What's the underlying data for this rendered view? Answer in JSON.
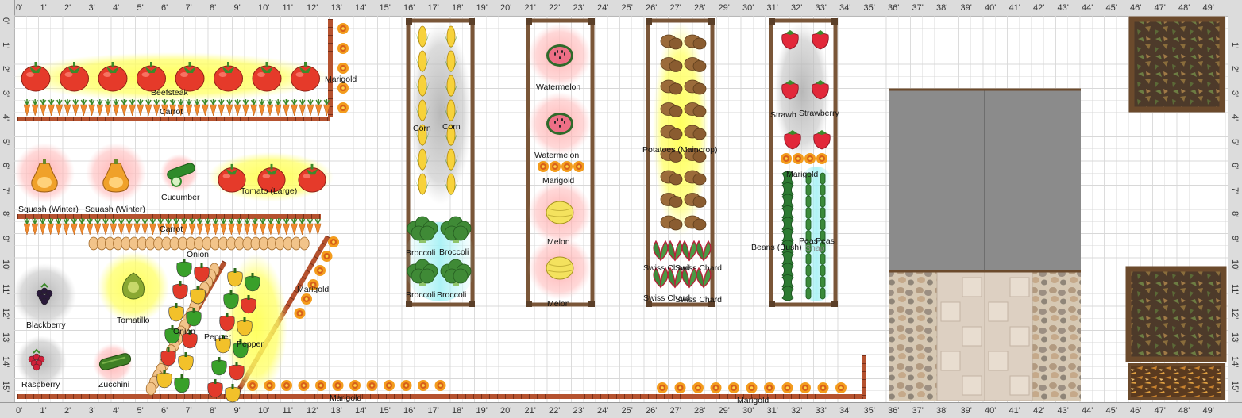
{
  "ruler": {
    "x_labels": [
      "0'",
      "1'",
      "2'",
      "3'",
      "4'",
      "5'",
      "6'",
      "7'",
      "8'",
      "9'",
      "10'",
      "11'",
      "12'",
      "13'",
      "14'",
      "15'",
      "16'",
      "17'",
      "18'",
      "19'",
      "20'",
      "21'",
      "22'",
      "23'",
      "24'",
      "25'",
      "26'",
      "27'",
      "28'",
      "29'",
      "30'",
      "31'",
      "32'",
      "33'",
      "34'",
      "35'",
      "36'",
      "37'",
      "38'",
      "39'",
      "40'",
      "41'",
      "42'",
      "43'",
      "44'",
      "45'",
      "46'",
      "47'",
      "48'",
      "49'"
    ],
    "y_labels": [
      "0'",
      "1'",
      "2'",
      "3'",
      "4'",
      "5'",
      "6'",
      "7'",
      "8'",
      "9'",
      "10'",
      "11'",
      "12'",
      "13'",
      "14'",
      "15'"
    ],
    "right_labels": [
      "1'",
      "2'",
      "3'",
      "4'",
      "5'",
      "6'",
      "7'",
      "8'",
      "9'",
      "10'",
      "11'",
      "12'",
      "13'",
      "14'",
      "15'"
    ]
  },
  "labels": {
    "beefsteak": "Beefsteak",
    "carrot": "Carrot",
    "marigold": "Marigold",
    "squash_winter": "Squash (Winter)",
    "cucumber": "Cucumber",
    "tomato_large": "Tomato (Large)",
    "onion": "Onion",
    "blackberry": "Blackberry",
    "tomatillo": "Tomatillo",
    "raspberry": "Raspberry",
    "zucchini": "Zucchini",
    "pepper": "Pepper",
    "corn": "Corn",
    "broccoli": "Broccoli",
    "watermelon": "Watermelon",
    "melon": "Melon",
    "potatoes": "Potatoes (Maincrop)",
    "swiss_chard": "Swiss Chard",
    "strawberry": "Strawberry",
    "strawb": "Strawb",
    "beans": "Beans (Bush)",
    "peas": "Peas",
    "snap": "Snap"
  },
  "colors": {
    "grid": "#d8d8d8",
    "ruler": "#dcdcdc",
    "bed_wood": "#7a5638",
    "sun_halo": "#ffff66",
    "warm_halo": "#ffb3b3",
    "shade_halo": "#bbbbbb",
    "water_halo": "#a8f0f4",
    "tomato": "#e53a2a",
    "carrot": "#f08a2c",
    "marigold": "#f39c1d",
    "brick": "#b5522f",
    "paving": "#8b8b8b",
    "stone": "#cbbba7"
  },
  "icons": [
    "tomato-icon",
    "carrot-icon",
    "marigold-icon",
    "squash-icon",
    "cucumber-icon",
    "onion-icon",
    "blackberry-icon",
    "tomatillo-icon",
    "raspberry-icon",
    "zucchini-icon",
    "pepper-icon",
    "corn-icon",
    "broccoli-icon",
    "watermelon-icon",
    "melon-icon",
    "potato-icon",
    "chard-icon",
    "strawberry-icon",
    "bean-icon",
    "pea-icon",
    "compost-icon",
    "mulch-icon"
  ]
}
